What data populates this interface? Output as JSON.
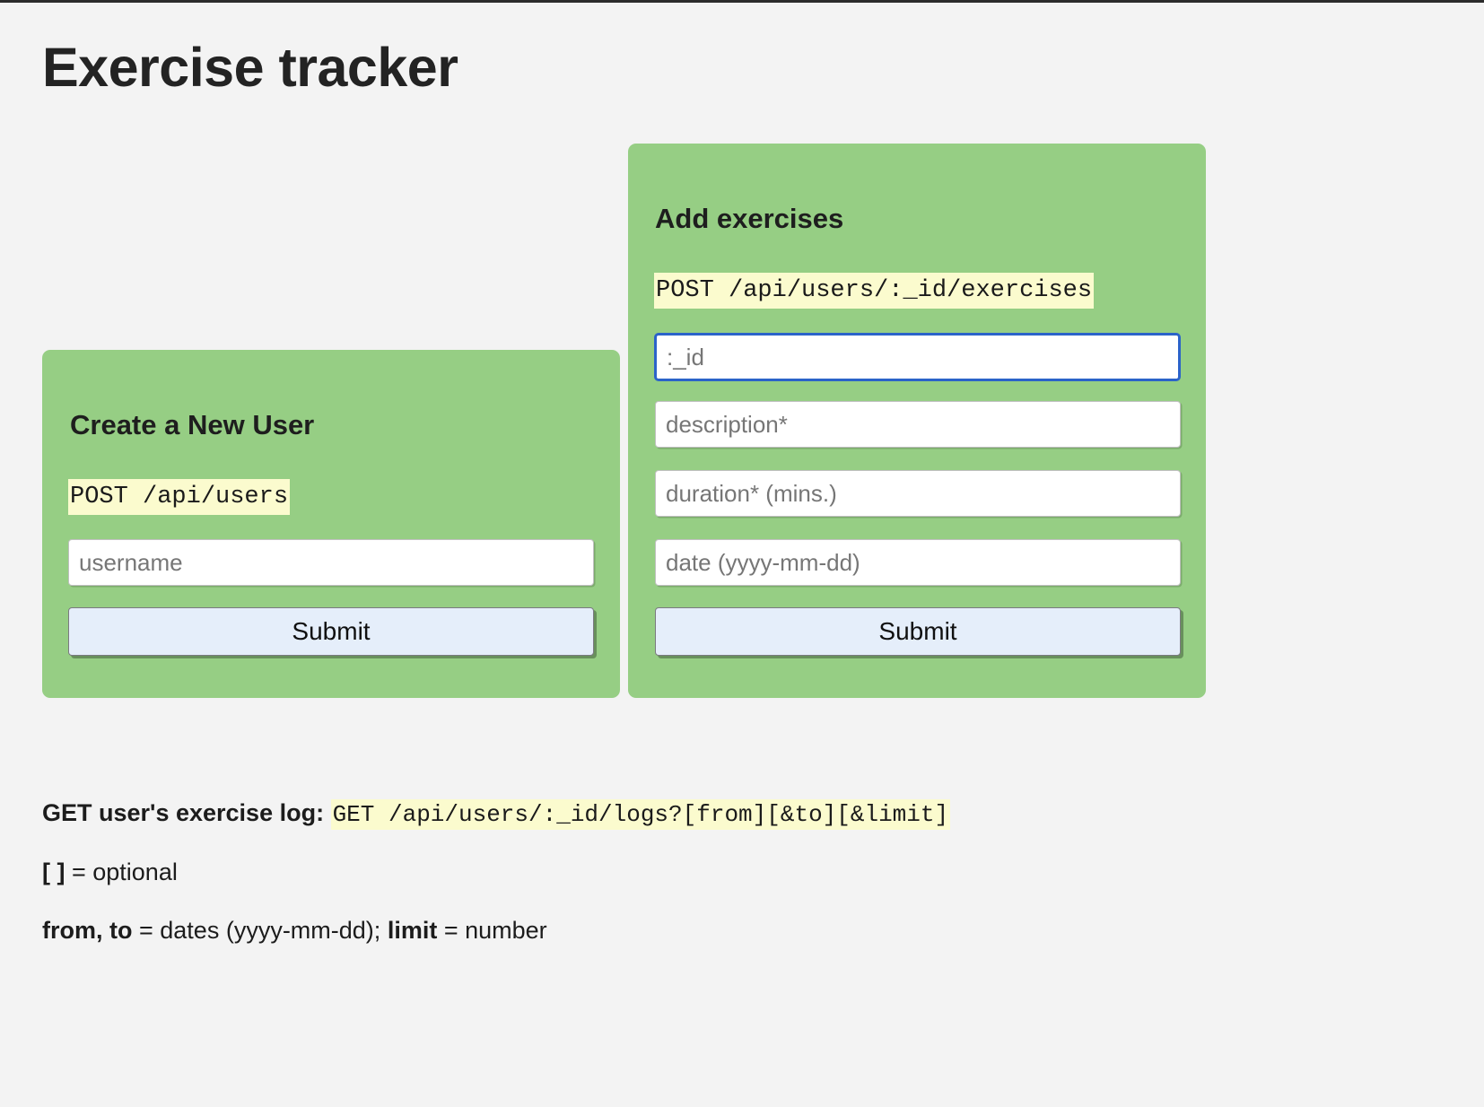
{
  "page": {
    "title": "Exercise tracker",
    "background_color": "#f3f3f3",
    "card_color": "#96ce84",
    "code_highlight_color": "#fbfbce",
    "button_color": "#e5eefa",
    "focus_border_color": "#2b63c9"
  },
  "create_user_card": {
    "title": "Create a New User",
    "endpoint": "POST /api/users",
    "username_placeholder": "username",
    "username_value": "",
    "submit_label": "Submit"
  },
  "add_exercises_card": {
    "title": "Add exercises",
    "endpoint": "POST /api/users/:_id/exercises",
    "id_placeholder": ":_id",
    "id_value": "",
    "description_placeholder": "description*",
    "description_value": "",
    "duration_placeholder": "duration* (mins.)",
    "duration_value": "",
    "date_placeholder": "date (yyyy-mm-dd)",
    "date_value": "",
    "submit_label": "Submit"
  },
  "notes": {
    "log_label": "GET user's exercise log:",
    "log_endpoint": "GET /api/users/:_id/logs?[from][&to][&limit]",
    "optional_bracket": "[ ]",
    "optional_text": " = optional",
    "params_bold_1": "from, to",
    "params_text_1": " = dates (yyyy-mm-dd); ",
    "params_bold_2": "limit",
    "params_text_2": " = number"
  }
}
